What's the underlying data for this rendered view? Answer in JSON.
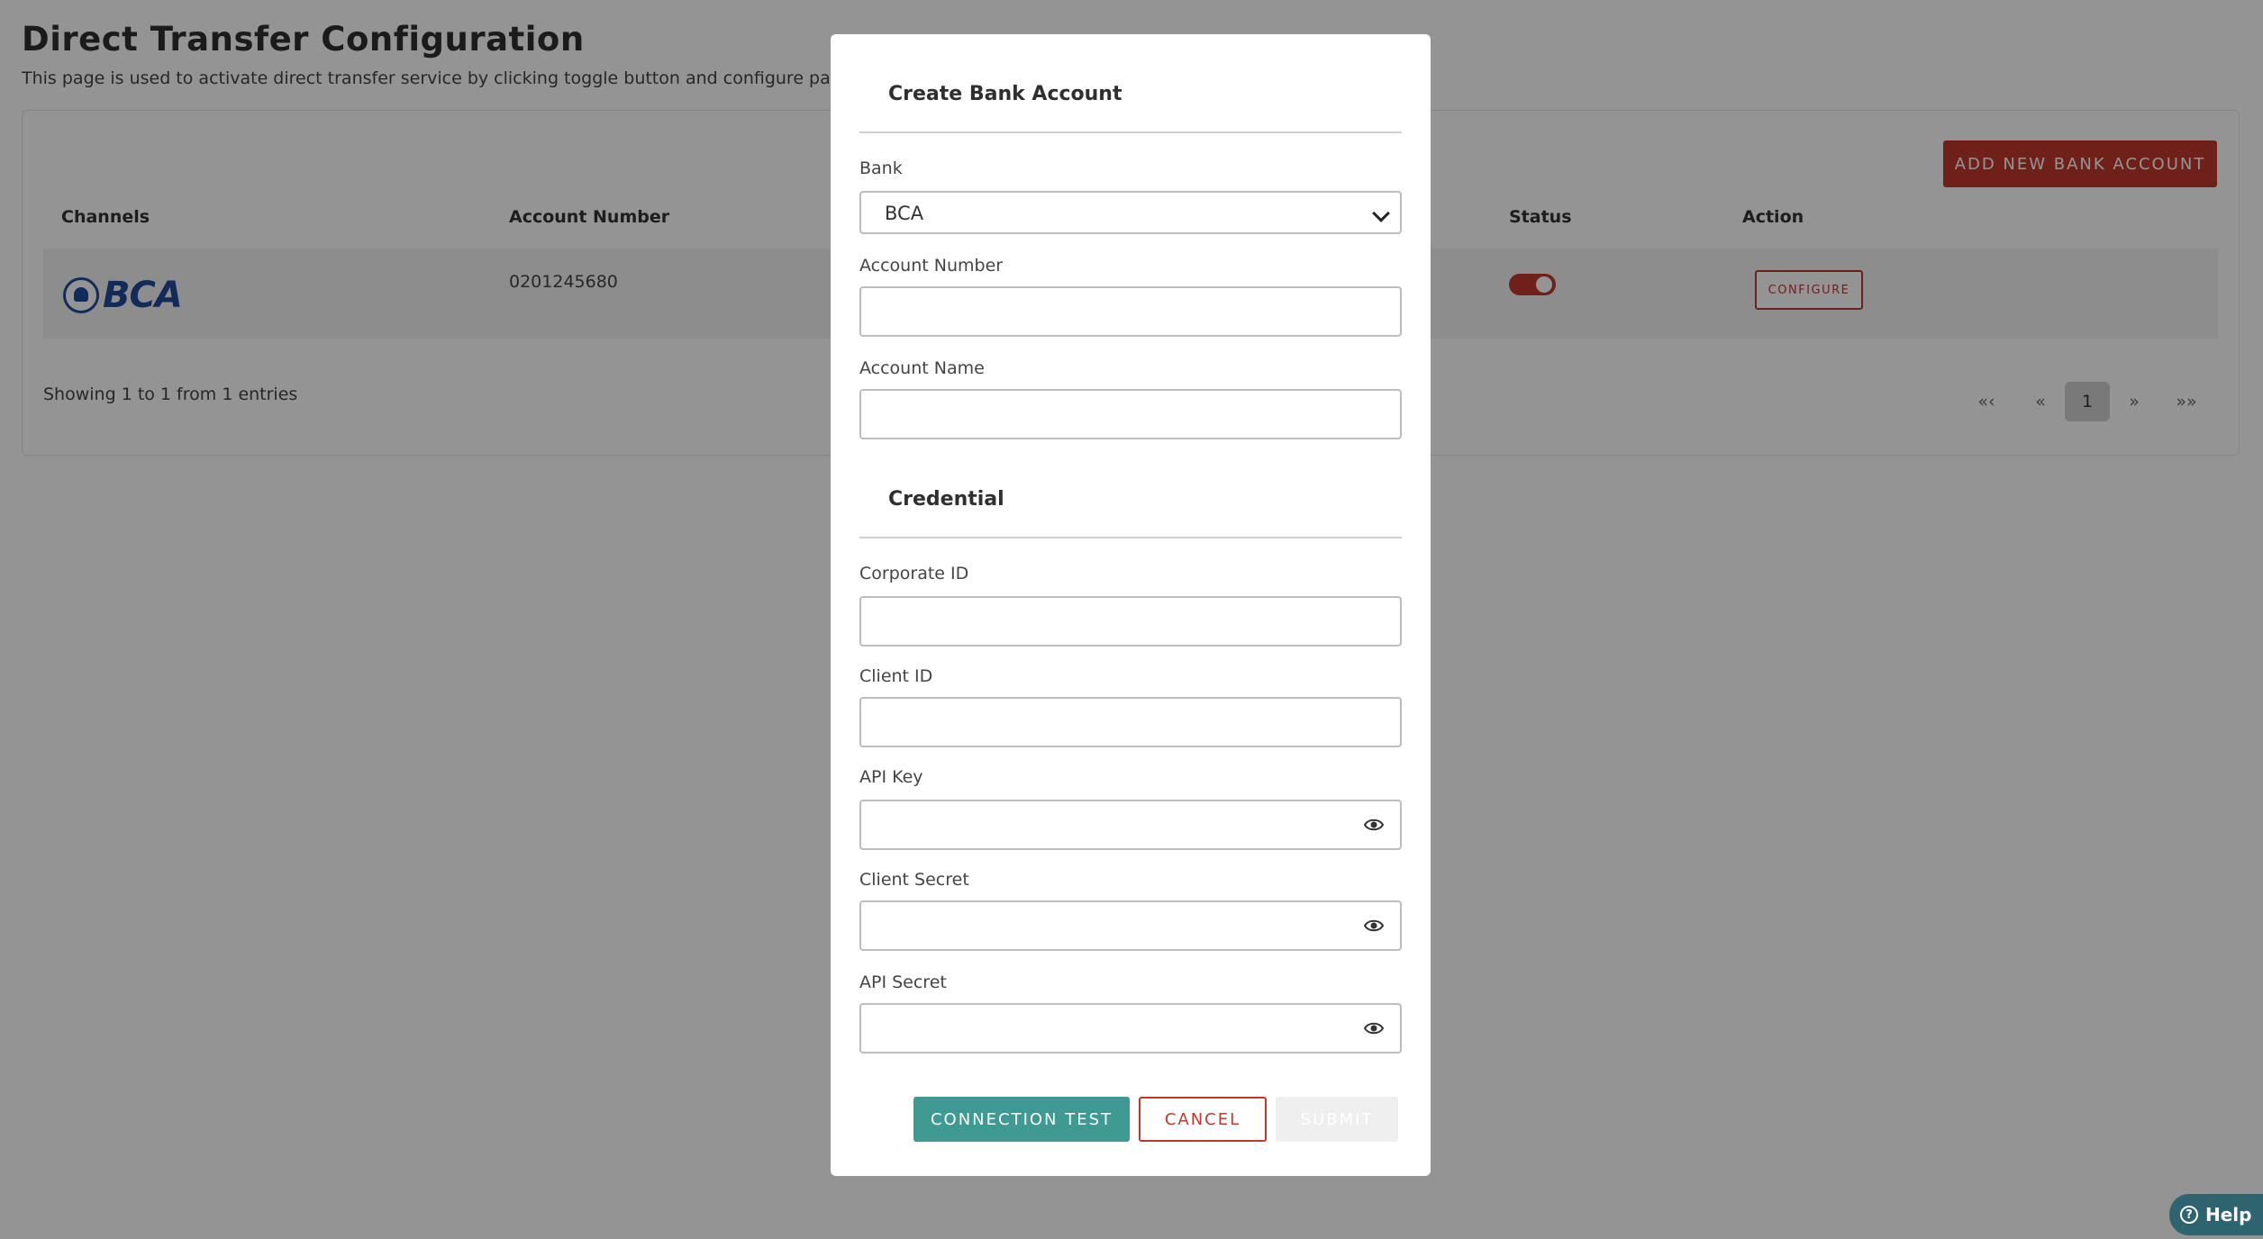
{
  "page": {
    "title": "Direct Transfer Configuration",
    "description": "This page is used to activate direct transfer service by clicking toggle button and configure payment noti"
  },
  "toolbar": {
    "add_label": "ADD NEW BANK ACCOUNT"
  },
  "table": {
    "headers": {
      "channels": "Channels",
      "account_number": "Account Number",
      "status": "Status",
      "action": "Action"
    },
    "rows": [
      {
        "channel_logo": "BCA",
        "account_number": "0201245680",
        "status_on": true,
        "action_label": "CONFIGURE"
      }
    ],
    "showing": "Showing 1 to 1 from 1 entries"
  },
  "pagination": {
    "first": "«‹",
    "prev": "«",
    "current": "1",
    "next": "»",
    "last": "»»"
  },
  "modal": {
    "title": "Create Bank Account",
    "bank": {
      "label": "Bank",
      "value": "BCA"
    },
    "account_number": {
      "label": "Account Number",
      "value": ""
    },
    "account_name": {
      "label": "Account Name",
      "value": ""
    },
    "credential_title": "Credential",
    "corporate_id": {
      "label": "Corporate ID",
      "value": ""
    },
    "client_id": {
      "label": "Client ID",
      "value": ""
    },
    "api_key": {
      "label": "API Key",
      "value": ""
    },
    "client_secret": {
      "label": "Client Secret",
      "value": ""
    },
    "api_secret": {
      "label": "API Secret",
      "value": ""
    },
    "buttons": {
      "connection_test": "CONNECTION TEST",
      "cancel": "CANCEL",
      "submit": "SUBMIT"
    }
  },
  "help": {
    "label": "Help"
  },
  "icons": {
    "eye": "eye-icon",
    "chevron": "chevron-down-icon",
    "help": "question-circle-icon"
  },
  "colors": {
    "accent": "#c0392b",
    "teal": "#3f9a93",
    "help_bg": "#2d6470"
  }
}
